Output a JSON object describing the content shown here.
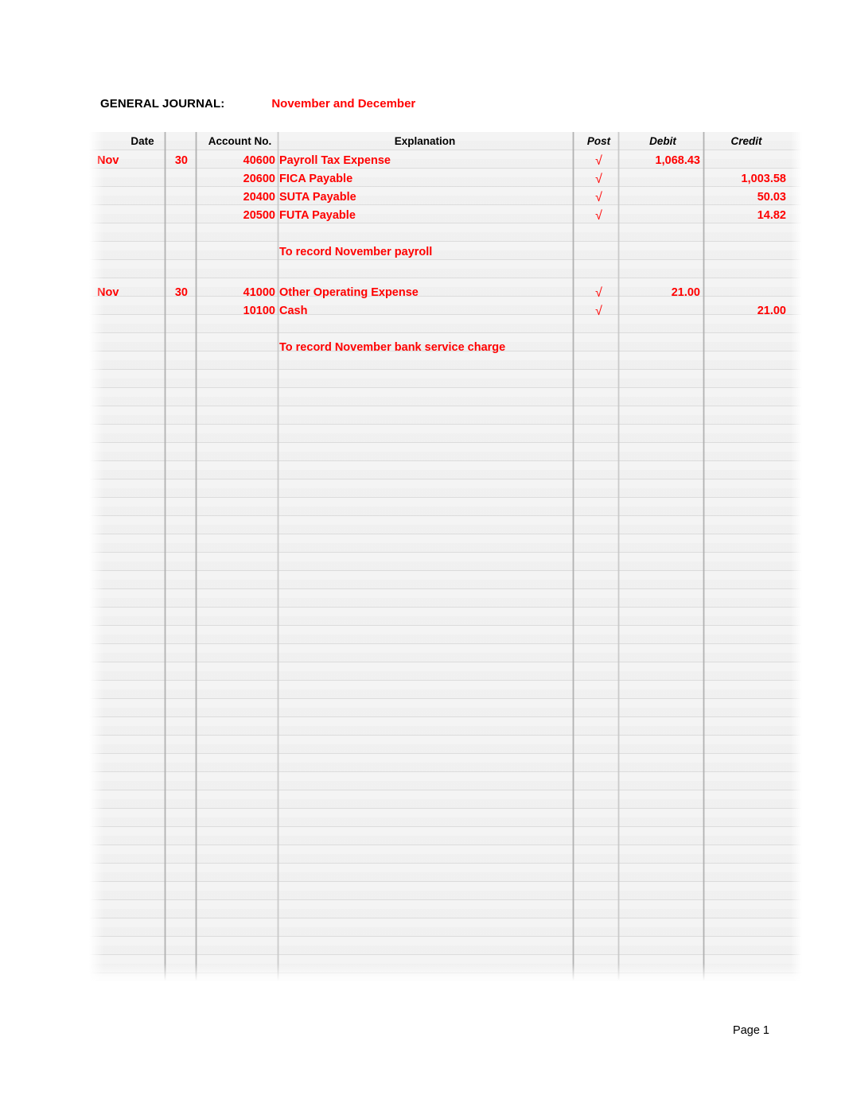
{
  "document": {
    "title_label": "GENERAL JOURNAL:",
    "period_label": "November and December",
    "footer": "Page 1",
    "accent_red": "#ff0000",
    "text_black": "#000000"
  },
  "table": {
    "headers": {
      "date": "Date",
      "account_no": "Account No.",
      "explanation": "Explanation",
      "post": "Post",
      "debit": "Debit",
      "credit": "Credit"
    },
    "post_mark": "√",
    "entries": [
      {
        "month": "Nov",
        "day": "30",
        "lines": [
          {
            "account_no": "40600",
            "explanation": "Payroll Tax Expense",
            "post": "√",
            "debit": "1,068.43",
            "credit": ""
          },
          {
            "account_no": "20600",
            "explanation": "FICA Payable",
            "post": "√",
            "debit": "",
            "credit": "1,003.58"
          },
          {
            "account_no": "20400",
            "explanation": "SUTA Payable",
            "post": "√",
            "debit": "",
            "credit": "50.03"
          },
          {
            "account_no": "20500",
            "explanation": "FUTA Payable",
            "post": "√",
            "debit": "",
            "credit": "14.82"
          }
        ],
        "memo": "To record November payroll"
      },
      {
        "month": "Nov",
        "day": "30",
        "lines": [
          {
            "account_no": "41000",
            "explanation": "Other Operating Expense",
            "post": "√",
            "debit": "21.00",
            "credit": ""
          },
          {
            "account_no": "10100",
            "explanation": "Cash",
            "post": "√",
            "debit": "",
            "credit": "21.00"
          }
        ],
        "memo": "To record November bank service charge"
      }
    ]
  }
}
